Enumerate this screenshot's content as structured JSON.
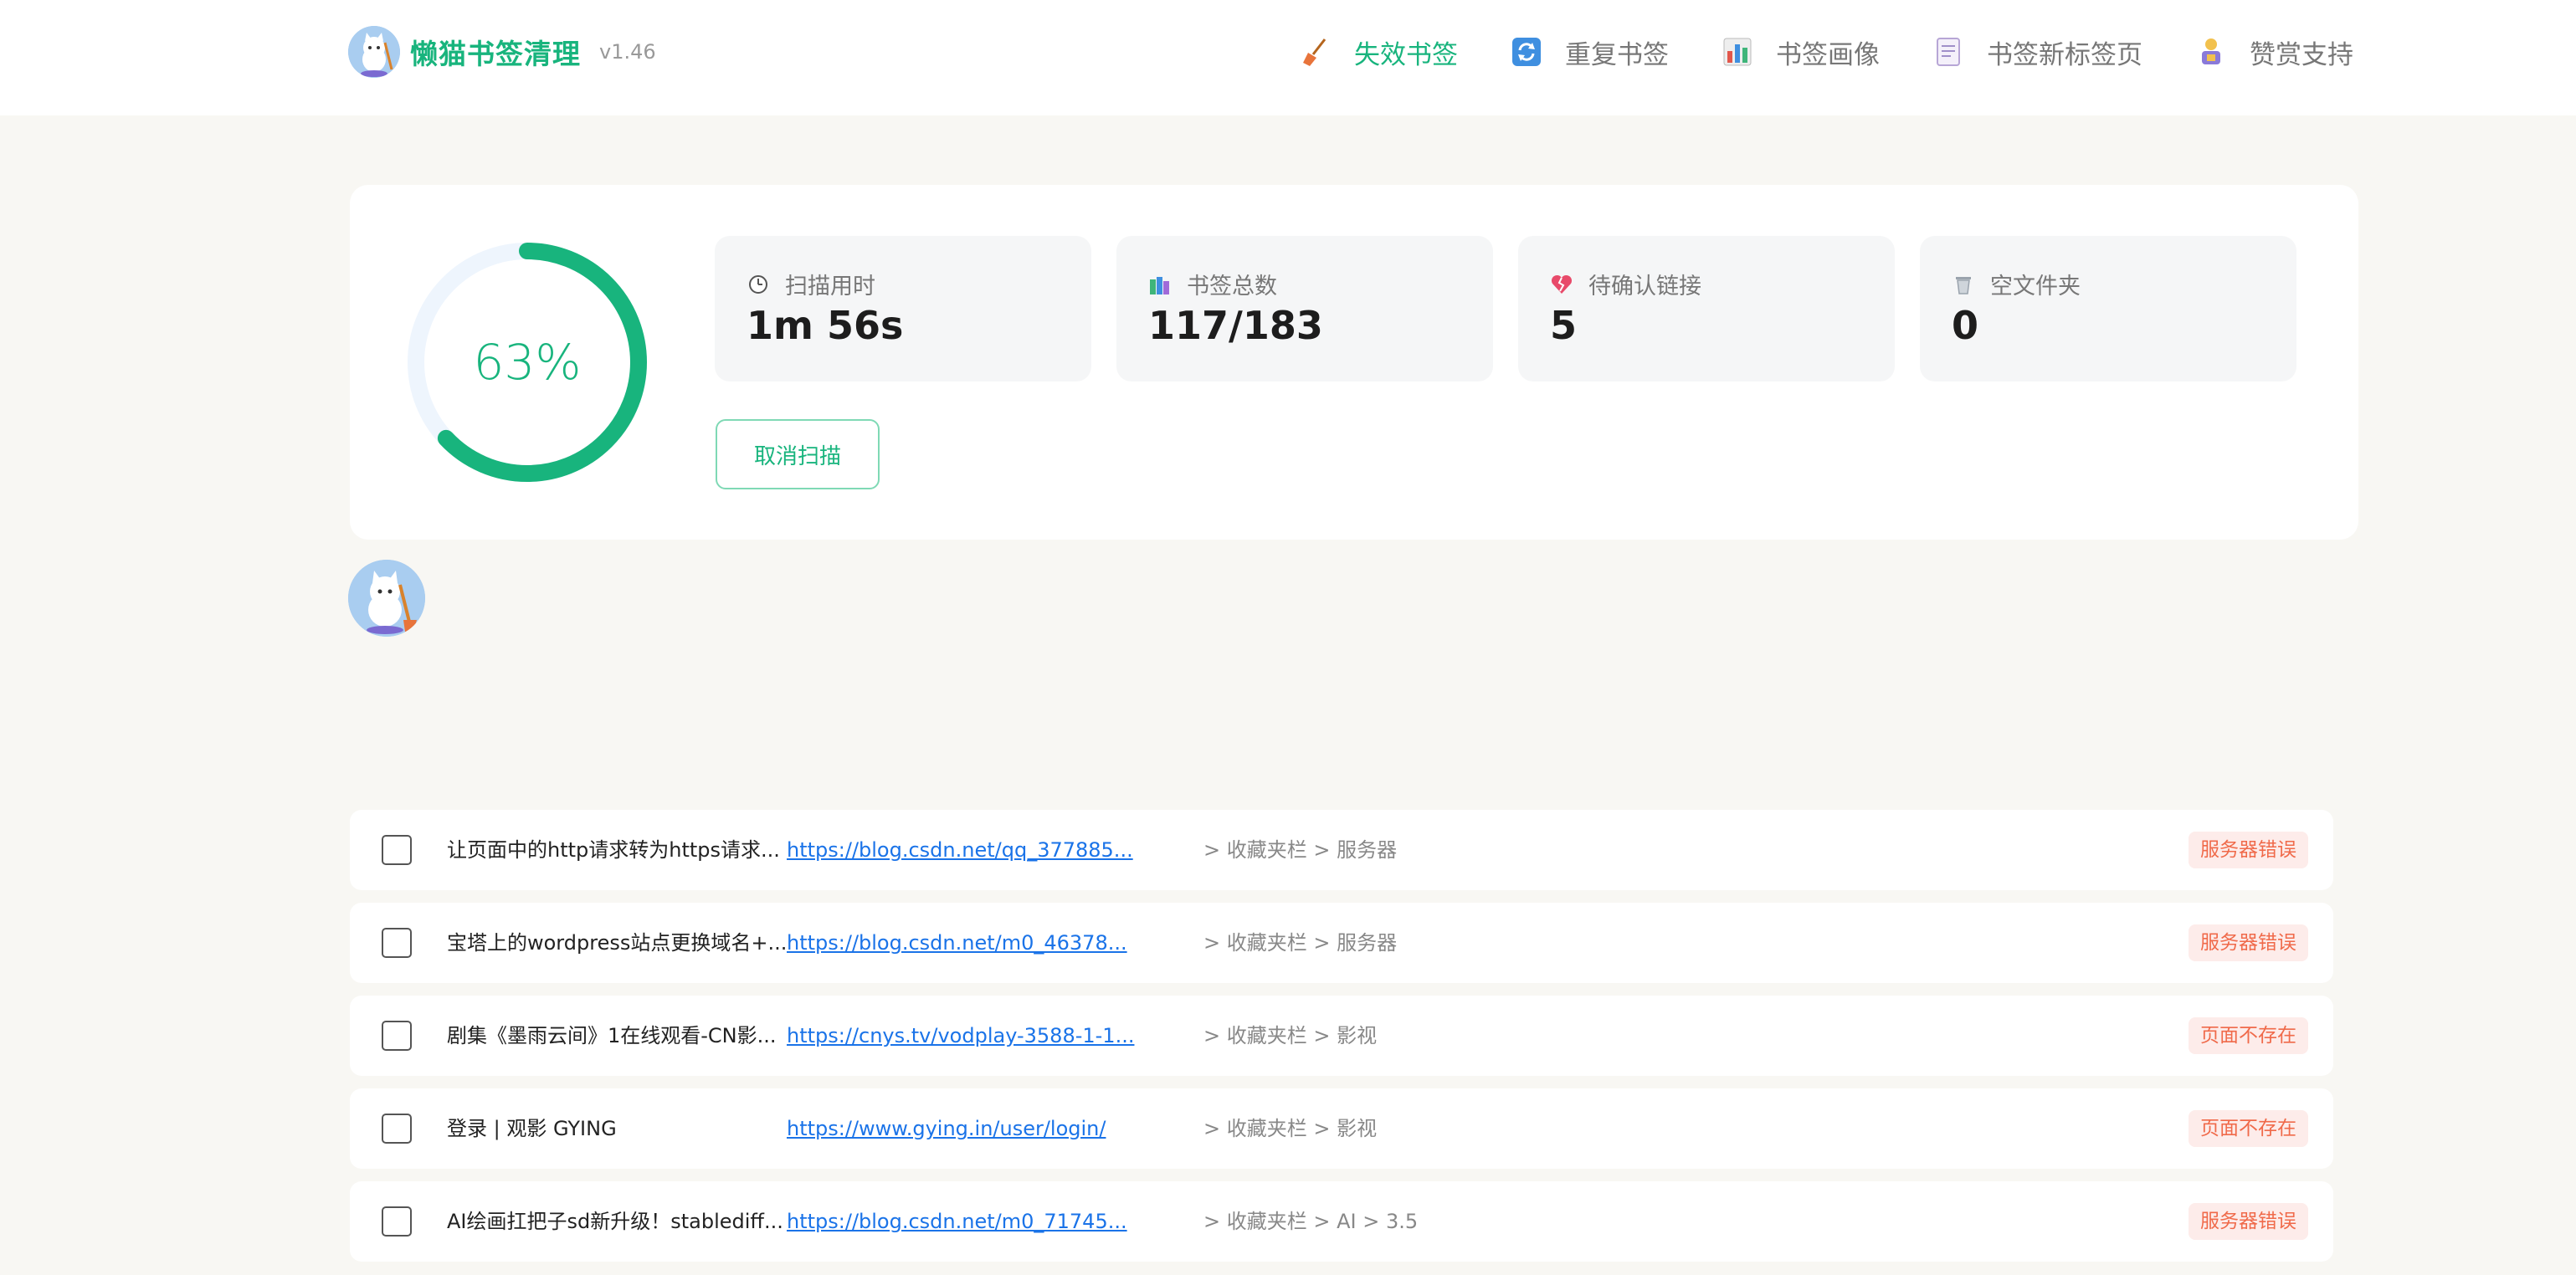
{
  "header": {
    "brand_title": "懒猫书签清理",
    "version": "v1.46",
    "nav": [
      {
        "label": "失效书签",
        "icon": "broom-icon",
        "active": true
      },
      {
        "label": "重复书签",
        "icon": "refresh-icon",
        "active": false
      },
      {
        "label": "书签画像",
        "icon": "bar-chart-icon",
        "active": false
      },
      {
        "label": "书签新标签页",
        "icon": "notepad-icon",
        "active": false
      },
      {
        "label": "赞赏支持",
        "icon": "donor-icon",
        "active": false
      }
    ]
  },
  "scan": {
    "progress_text": "63%",
    "progress_fraction": 0.63,
    "accent_color": "#18b47d",
    "stats": [
      {
        "label": "扫描用时",
        "value": "1m 56s",
        "icon": "clock-icon"
      },
      {
        "label": "书签总数",
        "value": "117/183",
        "icon": "books-icon"
      },
      {
        "label": "待确认链接",
        "value": "5",
        "icon": "broken-heart-icon"
      },
      {
        "label": "空文件夹",
        "value": "0",
        "icon": "trash-icon"
      }
    ],
    "cancel_label": "取消扫描"
  },
  "rows": [
    {
      "title": "让页面中的http请求转为https请求...",
      "url": "https://blog.csdn.net/qq_377885...",
      "path": "> 收藏夹栏 > 服务器",
      "status": "服务器错误"
    },
    {
      "title": "宝塔上的wordpress站点更换域名+...",
      "url": "https://blog.csdn.net/m0_46378...",
      "path": "> 收藏夹栏 > 服务器",
      "status": "服务器错误"
    },
    {
      "title": "剧集《墨雨云间》1在线观看-CN影...",
      "url": "https://cnys.tv/vodplay-3588-1-1...",
      "path": "> 收藏夹栏 > 影视",
      "status": "页面不存在"
    },
    {
      "title": "登录 | 观影 GYING",
      "url": "https://www.gying.in/user/login/",
      "path": "> 收藏夹栏 > 影视",
      "status": "页面不存在"
    },
    {
      "title": "AI绘画扛把子sd新升级！stablediff...",
      "url": "https://blog.csdn.net/m0_71745...",
      "path": "> 收藏夹栏 > AI > 3.5",
      "status": "服务器错误"
    }
  ]
}
